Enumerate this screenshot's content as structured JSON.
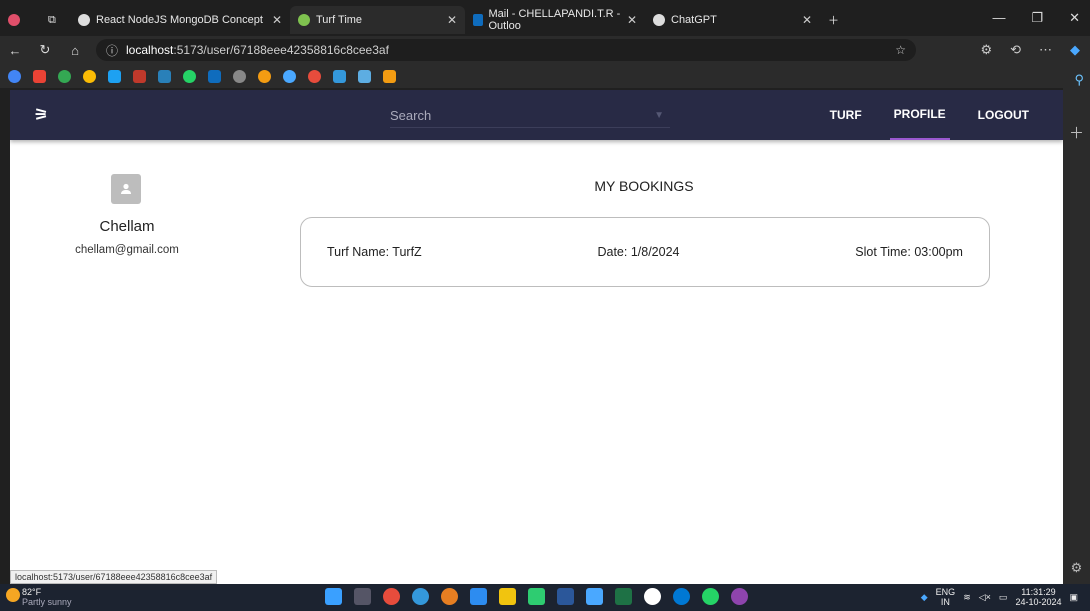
{
  "browser": {
    "tabs": [
      {
        "label": "React NodeJS MongoDB Concept",
        "icon": "chatgpt-icon",
        "active": false
      },
      {
        "label": "Turf Time",
        "icon": "turf-favicon",
        "active": true
      },
      {
        "label": "Mail - CHELLAPANDI.T.R - Outloo",
        "icon": "outlook-icon",
        "active": false
      },
      {
        "label": "ChatGPT",
        "icon": "chatgpt-icon",
        "active": false
      }
    ],
    "url_host": "localhost",
    "url_path": ":5173/user/67188eee42358816c8cee3af",
    "status_url": "localhost:5173/user/67188eee42358816c8cee3af"
  },
  "app": {
    "logo_text": "⚞",
    "search_placeholder": "Search",
    "nav": [
      {
        "label": "TURF",
        "active": false
      },
      {
        "label": "PROFILE",
        "active": true
      },
      {
        "label": "LOGOUT",
        "active": false
      }
    ],
    "accent_color": "#9b59d0",
    "appbar_color": "#282a45"
  },
  "profile": {
    "name": "Chellam",
    "email": "chellam@gmail.com"
  },
  "bookings": {
    "title": "MY BOOKINGS",
    "items": [
      {
        "turf": "Turf Name: TurfZ",
        "date": "Date: 1/8/2024",
        "slot": "Slot Time: 03:00pm"
      }
    ]
  },
  "taskbar": {
    "temp": "82°F",
    "weather": "Partly sunny",
    "lang1": "ENG",
    "lang2": "IN",
    "time": "11:31:29",
    "date": "24-10-2024"
  }
}
